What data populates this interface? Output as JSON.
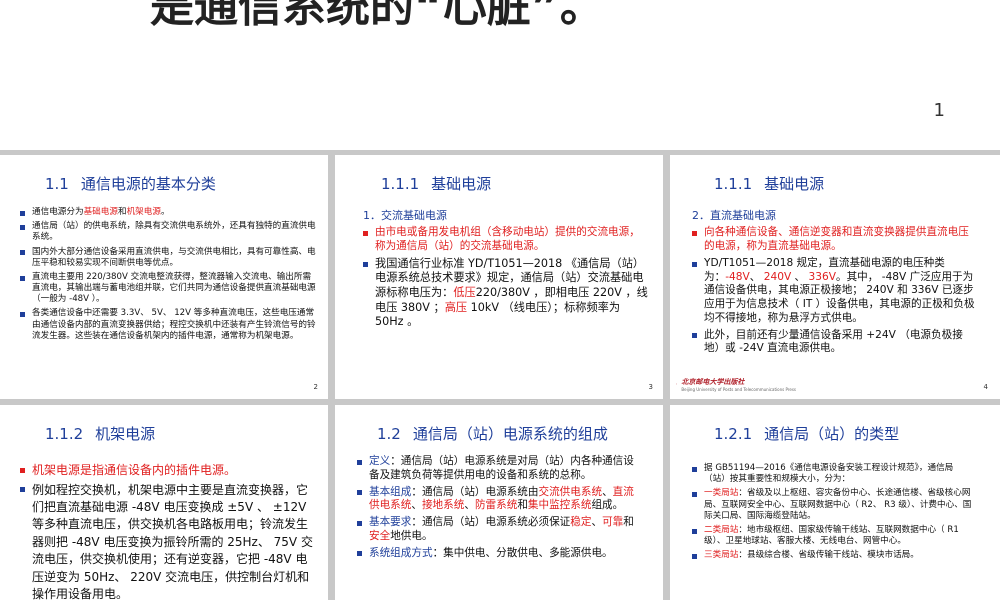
{
  "top": {
    "title": "是通信系统的“心脏”。",
    "page_number": "1"
  },
  "slide2": {
    "num": "1.1",
    "title": "通信电源的基本分类",
    "b1_a": "通信电源分为",
    "b1_r1": "基础电源",
    "b1_b": "和",
    "b1_r2": "机架电源",
    "b1_c": "。",
    "b2": "通信局（站）的供电系统，除具有交流供电系统外，还具有独特的直流供电系统。",
    "b3": "国内外大部分通信设备采用直流供电，与交流供电相比，具有可靠性高、电压平稳和较易实现不间断供电等优点。",
    "b4": "直流电主要用 220/380V 交流电整流获得，整流器输入交流电、输出所需直流电，其输出端与蓄电池组并联，它们共同为通信设备提供直流基础电源（一般为 -48V ）。",
    "b5": "各类通信设备中还需要 3.3V、 5V、 12V 等多种直流电压，这些电压通常由通信设备内部的直流变换器供给；程控交换机中还装有产生铃流信号的铃流发生器。这些装在通信设备机架内的插件电源，通常称为机架电源。",
    "page": "2"
  },
  "slide3": {
    "num": "1.1.1",
    "title": "基础电源",
    "subhead": "1．交流基础电源",
    "b1": "由市电或备用发电机组（含移动电站）提供的交流电源，称为通信局（站）的交流基础电源。",
    "b2_a": "我国通信行业标准 YD/T1051—2018 《通信局（站）电源系统总技术要求》规定，通信局（站）交流基础电源标称电压为：",
    "b2_r1": "低压",
    "b2_b": "220/380V ，即相电压 220V ，线电压 380V ；",
    "b2_r2": "高压",
    "b2_c": " 10kV （线电压）；标称频率为 50Hz 。",
    "page": "3"
  },
  "slide4": {
    "num": "1.1.1",
    "title": "基础电源",
    "subhead": "2．直流基础电源",
    "b1": "向各种通信设备、通信逆变器和直流变换器提供直流电压的电源，称为直流基础电源。",
    "b2_a": "YD/T1051—2018 规定，直流基础电源的电压种类为：",
    "b2_r1": "-48V",
    "b2_s1": "、 ",
    "b2_r2": "240V",
    "b2_s2": " 、 ",
    "b2_r3": "336V",
    "b2_b": "。其中， -48V 广泛应用于为通信设备供电，其电源正极接地； 240V 和 336V 已逐步应用于为信息技术（ IT ）设备供电，其电源的正极和负极均不得接地，称为悬浮方式供电。",
    "b3": "此外，目前还有少量通信设备采用 +24V （电源负极接地）或 -24V 直流电源供电。",
    "logo_text": "北京邮电大学出版社",
    "logo_sub": "Beijing University of Posts and Telecommunications Press",
    "page": "4"
  },
  "slide5": {
    "num": "1.1.2",
    "title": "机架电源",
    "b1": "机架电源是指通信设备内的插件电源。",
    "b2": "例如程控交换机，机架电源中主要是直流变换器，它们把直流基础电源 -48V 电压变换成 ±5V 、 ±12V 等多种直流电压，供交换机各电路板用电；铃流发生器则把 -48V 电压变换为振铃所需的 25Hz、 75V 交流电压，供交换机使用；还有逆变器，它把 -48V 电压逆变为 50Hz、 220V 交流电压，供控制台灯机和操作用设备用电。"
  },
  "slide6": {
    "num": "1.2",
    "title": "通信局（站）电源系统的组成",
    "b1_a": "定义",
    "b1_b": "：通信局（站）电源系统是对局（站）内各种通信设备及建筑负荷等提供用电的设备和系统的总称。",
    "b2_a": "基本组成",
    "b2_b": "：通信局（站）电源系统由",
    "b2_r1": "交流供电系统",
    "b2_c": "、",
    "b2_r2": "直流供电系统",
    "b2_d": "、",
    "b2_r3": "接地系统",
    "b2_e": "、",
    "b2_r4": "防雷系统",
    "b2_f": "和",
    "b2_r5": "集中监控系统",
    "b2_g": "组成。",
    "b3_a": "基本要求",
    "b3_b": "：通信局（站）电源系统必须保证",
    "b3_r1": "稳定",
    "b3_c": "、",
    "b3_r2": "可靠",
    "b3_d": "和",
    "b3_r3": "安全",
    "b3_e": "地供电。",
    "b4_a": "系统组成方式",
    "b4_b": "：集中供电、分散供电、多能源供电。"
  },
  "slide7": {
    "num": "1.2.1",
    "title": "通信局（站）的类型",
    "b1": "据 GB51194—2016《通信电源设备安装工程设计规范》，通信局（站）按其重要性和规模大小，分为：",
    "b2_r": "一类局站",
    "b2": "：省级及以上枢纽、容灾备份中心、长途通信楼、省级核心网局、互联网安全中心、互联网数据中心（ R2、 R3 级）、计费中心、国际关口局、国际海缆登陆站。",
    "b3_r": "二类局站",
    "b3": "：地市级枢纽、国家级传输干线站、互联网数据中心（ R1 级）、卫星地球站、客服大楼、无线电台、网管中心。",
    "b4_r": "三类局站",
    "b4": "：县级综合楼、省级传输干线站、模块市话局。"
  }
}
